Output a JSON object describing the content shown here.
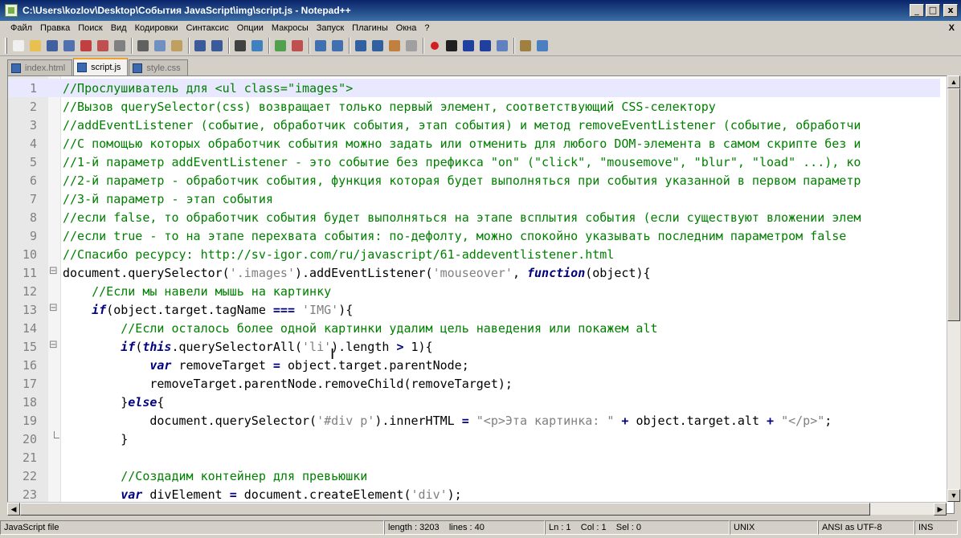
{
  "window": {
    "title": "C:\\Users\\kozlov\\Desktop\\События JavaScript\\img\\script.js - Notepad++",
    "min": "_",
    "max": "□",
    "close": "x"
  },
  "menu": [
    "Файл",
    "Правка",
    "Поиск",
    "Вид",
    "Кодировки",
    "Синтаксис",
    "Опции",
    "Макросы",
    "Запуск",
    "Плагины",
    "Окна",
    "?"
  ],
  "menu_close": "X",
  "toolbar_icons": [
    "new-file-icon",
    "open-file-icon",
    "save-icon",
    "save-all-icon",
    "close-icon",
    "close-all-icon",
    "print-icon",
    "cut-icon",
    "copy-icon",
    "paste-icon",
    "undo-icon",
    "redo-icon",
    "find-icon",
    "replace-icon",
    "zoom-in-icon",
    "zoom-out-icon",
    "sync-vertical-icon",
    "sync-horizontal-icon",
    "word-wrap-icon",
    "show-all-chars-icon",
    "indent-guide-icon",
    "doc-map-icon",
    "record-macro-icon",
    "stop-macro-icon",
    "play-macro-icon",
    "run-macro-multiple-icon",
    "save-macro-icon",
    "launch-browser-icon",
    "spellcheck-icon"
  ],
  "tabs": [
    {
      "label": "index.html",
      "active": false
    },
    {
      "label": "script.js",
      "active": true
    },
    {
      "label": "style.css",
      "active": false
    }
  ],
  "lines": [
    {
      "n": "1",
      "fold": "",
      "indent": "",
      "parts": [
        [
          "c",
          "//Прослушиватель для <ul class=\"images\">"
        ]
      ]
    },
    {
      "n": "2",
      "fold": "",
      "indent": "",
      "parts": [
        [
          "c",
          "//Вызов querySelector(css) возвращает только первый элемент, соответствующий CSS-селектору"
        ]
      ]
    },
    {
      "n": "3",
      "fold": "",
      "indent": "",
      "parts": [
        [
          "c",
          "//addEventListener (событие, обработчик события, этап события) и метод removeEventListener (событие, обработчи"
        ]
      ]
    },
    {
      "n": "4",
      "fold": "",
      "indent": "",
      "parts": [
        [
          "c",
          "//С помощью которых обработчик события можно задать или отменить для любого DOM-элемента в самом скрипте без и"
        ]
      ]
    },
    {
      "n": "5",
      "fold": "",
      "indent": "",
      "parts": [
        [
          "c",
          "//1-й параметр addEventListener - это событие без префикса \"on\" (\"click\", \"mousemove\", \"blur\", \"load\" ...), ко"
        ]
      ]
    },
    {
      "n": "6",
      "fold": "",
      "indent": "",
      "parts": [
        [
          "c",
          "//2-й параметр - обработчик события, функция которая будет выполняться при события указанной в первом параметр"
        ]
      ]
    },
    {
      "n": "7",
      "fold": "",
      "indent": "",
      "parts": [
        [
          "c",
          "//3-й параметр - этап события"
        ]
      ]
    },
    {
      "n": "8",
      "fold": "",
      "indent": "",
      "parts": [
        [
          "c",
          "//если false, то обработчик события будет выполняться на этапе всплытия события (если существуют вложении элем"
        ]
      ]
    },
    {
      "n": "9",
      "fold": "",
      "indent": "",
      "parts": [
        [
          "c",
          "//если true - то на этапе перехвата события: по-дефолту, можно спокойно указывать последним параметром false"
        ]
      ]
    },
    {
      "n": "10",
      "fold": "",
      "indent": "",
      "parts": [
        [
          "c",
          "//Спасибо ресурсу: http://sv-igor.com/ru/javascript/61-addeventlistener.html"
        ]
      ]
    },
    {
      "n": "11",
      "fold": "box",
      "indent": "",
      "parts": [
        [
          "t",
          "document.querySelector("
        ],
        [
          "s",
          "'.images'"
        ],
        [
          "t",
          ").addEventListener("
        ],
        [
          "s",
          "'mouseover'"
        ],
        [
          "t",
          ", "
        ],
        [
          "k",
          "function"
        ],
        [
          "t",
          "(object){"
        ]
      ]
    },
    {
      "n": "12",
      "fold": "",
      "indent": "    ",
      "parts": [
        [
          "c",
          "//Если мы навели мышь на картинку"
        ]
      ]
    },
    {
      "n": "13",
      "fold": "box",
      "indent": "    ",
      "parts": [
        [
          "k",
          "if"
        ],
        [
          "t",
          "(object.target.tagName "
        ],
        [
          "op",
          "==="
        ],
        [
          "t",
          " "
        ],
        [
          "s",
          "'IMG'"
        ],
        [
          "t",
          "){"
        ]
      ]
    },
    {
      "n": "14",
      "fold": "",
      "indent": "        ",
      "parts": [
        [
          "c",
          "//Если осталось более одной картинки удалим цель наведения или покажем alt"
        ]
      ]
    },
    {
      "n": "15",
      "fold": "box",
      "indent": "        ",
      "parts": [
        [
          "k",
          "if"
        ],
        [
          "t",
          "("
        ],
        [
          "k",
          "this"
        ],
        [
          "t",
          ".querySelectorAll("
        ],
        [
          "s",
          "'li'"
        ],
        [
          "t",
          ").length "
        ],
        [
          "op",
          ">"
        ],
        [
          "t",
          " 1){"
        ]
      ]
    },
    {
      "n": "16",
      "fold": "",
      "indent": "            ",
      "parts": [
        [
          "k",
          "var"
        ],
        [
          "t",
          " removeTarget "
        ],
        [
          "op",
          "="
        ],
        [
          "t",
          " object.target.parentNode;"
        ]
      ]
    },
    {
      "n": "17",
      "fold": "",
      "indent": "            ",
      "parts": [
        [
          "t",
          "removeTarget.parentNode.removeChild(removeTarget);"
        ]
      ]
    },
    {
      "n": "18",
      "fold": "",
      "indent": "        ",
      "parts": [
        [
          "t",
          "}"
        ],
        [
          "k",
          "else"
        ],
        [
          "t",
          "{"
        ]
      ]
    },
    {
      "n": "19",
      "fold": "",
      "indent": "            ",
      "parts": [
        [
          "t",
          "document.querySelector("
        ],
        [
          "s",
          "'#div p'"
        ],
        [
          "t",
          ").innerHTML "
        ],
        [
          "op",
          "="
        ],
        [
          "t",
          " "
        ],
        [
          "s",
          "\"<p>Эта картинка: \""
        ],
        [
          "t",
          " "
        ],
        [
          "op",
          "+"
        ],
        [
          "t",
          " object.target.alt "
        ],
        [
          "op",
          "+"
        ],
        [
          "t",
          " "
        ],
        [
          "s",
          "\"</p>\""
        ],
        [
          "t",
          ";"
        ]
      ]
    },
    {
      "n": "20",
      "fold": "end",
      "indent": "        ",
      "parts": [
        [
          "t",
          "}"
        ]
      ]
    },
    {
      "n": "21",
      "fold": "",
      "indent": "",
      "parts": [
        [
          "t",
          ""
        ]
      ]
    },
    {
      "n": "22",
      "fold": "",
      "indent": "        ",
      "parts": [
        [
          "c",
          "//Создадим контейнер для превьюшки"
        ]
      ]
    },
    {
      "n": "23",
      "fold": "",
      "indent": "        ",
      "parts": [
        [
          "k",
          "var"
        ],
        [
          "t",
          " divElement "
        ],
        [
          "op",
          "="
        ],
        [
          "t",
          " document.createElement("
        ],
        [
          "s",
          "'div'"
        ],
        [
          "t",
          ");"
        ]
      ]
    }
  ],
  "status": {
    "file_type": "JavaScript file",
    "length": "length : 3203",
    "lines": "lines : 40",
    "ln": "Ln : 1",
    "col": "Col : 1",
    "sel": "Sel : 0",
    "eol": "UNIX",
    "encoding": "ANSI as UTF-8",
    "mode": "INS"
  },
  "colors": {
    "comment": "#008000",
    "string": "#808080",
    "keyword": "#000080",
    "current_line": "#e8e8ff",
    "title_bar": "#0a246a"
  }
}
